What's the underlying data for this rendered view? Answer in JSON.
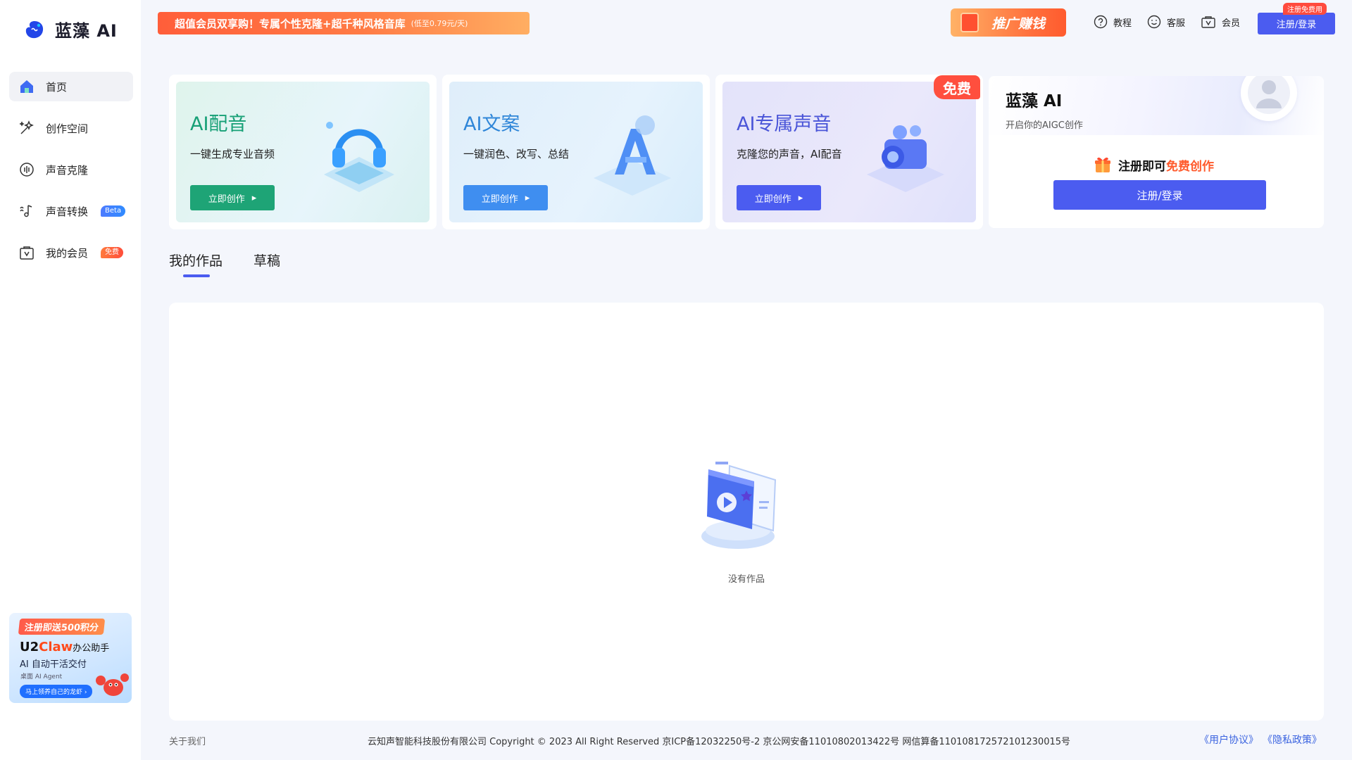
{
  "app": {
    "name": "蓝藻 AI"
  },
  "sidebar": {
    "items": [
      {
        "label": "首页",
        "icon": "home-icon"
      },
      {
        "label": "创作空间",
        "icon": "sparkle-icon"
      },
      {
        "label": "声音克隆",
        "icon": "voice-wave-icon"
      },
      {
        "label": "声音转换",
        "icon": "voice-convert-icon",
        "badge": "Beta"
      },
      {
        "label": "我的会员",
        "icon": "membership-icon",
        "badge": "免费"
      }
    ],
    "promo": {
      "tag": "注册即送500积分",
      "title_a": "U2",
      "title_b": "Claw",
      "title_c": "办公助手",
      "subtitle": "AI 自动干活交付",
      "note": "桌面 AI Agent",
      "button": "马上领养自己的龙虾"
    }
  },
  "header": {
    "banner": {
      "text": "超值会员双享购！专属个性克隆+超千种风格音库",
      "small": "(低至0.79元/天)"
    },
    "earn_promo": "推广赚钱",
    "links": [
      {
        "label": "教程",
        "icon": "help-circle-icon"
      },
      {
        "label": "客服",
        "icon": "smile-icon"
      },
      {
        "label": "会员",
        "icon": "vip-bag-icon"
      }
    ],
    "login_button": "注册/登录",
    "login_badge": "注册免费用"
  },
  "cards": [
    {
      "title": "AI配音",
      "desc": "一键生成专业音频",
      "button": "立即创作"
    },
    {
      "title": "AI文案",
      "desc": "一键润色、改写、总结",
      "button": "立即创作"
    },
    {
      "title": "AI专属声音",
      "desc": "克隆您的声音，AI配音",
      "button": "立即创作",
      "ribbon": "免费"
    }
  ],
  "login_card": {
    "brand": "蓝藻 AI",
    "subtitle": "开启你的AIGC创作",
    "promo_prefix": "注册即可",
    "promo_highlight": "免费创作",
    "button": "注册/登录"
  },
  "tabs": [
    {
      "label": "我的作品",
      "active": true
    },
    {
      "label": "草稿",
      "active": false
    }
  ],
  "works": {
    "empty_text": "没有作品"
  },
  "footer": {
    "about": "关于我们",
    "copyright": "云知声智能科技股份有限公司 Copyright © 2023 All Right Reserved 京ICP备12032250号-2 京公网安备11010802013422号 网信算备110108172572101230015号",
    "user_agreement": "《用户协议》",
    "privacy_policy": "《隐私政策》"
  },
  "colors": {
    "primary": "#4b5cf0",
    "green": "#1ea476",
    "blue": "#3f8ef0",
    "accent_orange": "#ff5a2c",
    "background": "#f4f6fc"
  }
}
